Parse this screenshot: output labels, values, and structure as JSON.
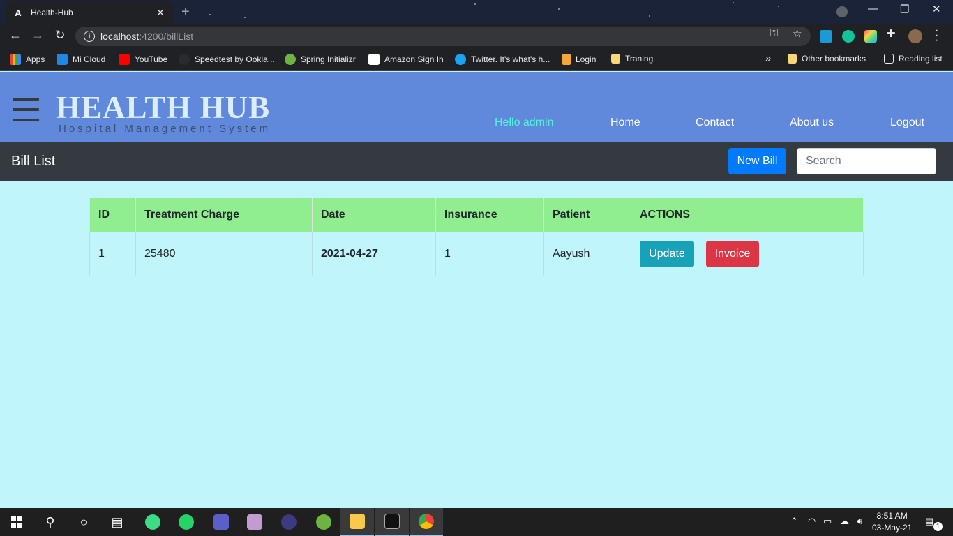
{
  "browser": {
    "tab_title": "Health-Hub",
    "tab_favicon": "A",
    "url_host": "localhost",
    "url_path": ":4200/billList",
    "bookmarks": [
      {
        "label": "Apps",
        "icon": "apps-grid-icon"
      },
      {
        "label": "Mi Cloud",
        "icon": "mi-cloud-icon"
      },
      {
        "label": "YouTube",
        "icon": "youtube-icon"
      },
      {
        "label": "Speedtest by Ookla...",
        "icon": "speedtest-icon"
      },
      {
        "label": "Spring Initializr",
        "icon": "spring-icon"
      },
      {
        "label": "Amazon Sign In",
        "icon": "amazon-icon"
      },
      {
        "label": "Twitter. It's what's h...",
        "icon": "twitter-icon"
      },
      {
        "label": "Login",
        "icon": "login-icon"
      },
      {
        "label": "Traning",
        "icon": "folder-icon"
      }
    ],
    "overflow": "»",
    "other_bookmarks": "Other bookmarks",
    "reading_list": "Reading list"
  },
  "header": {
    "brand_name": "HEALTH HUB",
    "brand_sub": "Hospital Management System",
    "greeting": "Hello admin",
    "nav": [
      "Home",
      "Contact",
      "About us",
      "Logout"
    ]
  },
  "subbar": {
    "title": "Bill List",
    "new_bill": "New Bill",
    "search_placeholder": "Search"
  },
  "table": {
    "columns": [
      "ID",
      "Treatment Charge",
      "Date",
      "Insurance",
      "Patient",
      "ACTIONS"
    ],
    "rows": [
      {
        "id": "1",
        "charge": "25480",
        "date": "2021-04-27",
        "insurance": "1",
        "patient": "Aayush",
        "update": "Update",
        "invoice": "Invoice"
      }
    ]
  },
  "taskbar": {
    "time": "8:51 AM",
    "date": "03-May-21",
    "notifications": "1"
  },
  "colors": {
    "header_bg": "#6089db",
    "subbar_bg": "#343a40",
    "page_bg": "#c0f5fc",
    "table_head": "#90ee90",
    "primary": "#007bff",
    "info": "#17a2b8",
    "danger": "#dc3545",
    "greeting": "#52f5dc"
  }
}
